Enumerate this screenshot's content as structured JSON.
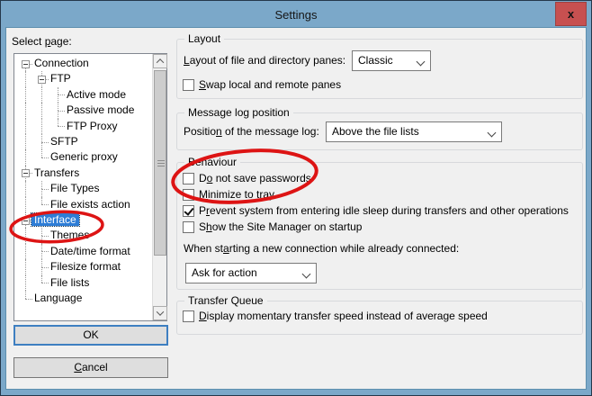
{
  "window": {
    "title": "Settings",
    "close_glyph": "x"
  },
  "sidebar": {
    "label": {
      "text": "Select page:",
      "accel": 7
    },
    "tree": [
      {
        "label": "Connection",
        "level": 0,
        "expand": true
      },
      {
        "label": "FTP",
        "level": 1,
        "expand": true
      },
      {
        "label": "Active mode",
        "level": 2
      },
      {
        "label": "Passive mode",
        "level": 2
      },
      {
        "label": "FTP Proxy",
        "level": 2
      },
      {
        "label": "SFTP",
        "level": 1
      },
      {
        "label": "Generic proxy",
        "level": 1
      },
      {
        "label": "Transfers",
        "level": 0,
        "expand": true
      },
      {
        "label": "File Types",
        "level": 1
      },
      {
        "label": "File exists action",
        "level": 1
      },
      {
        "label": "Interface",
        "level": 0,
        "expand": true,
        "selected": true
      },
      {
        "label": "Themes",
        "level": 1
      },
      {
        "label": "Date/time format",
        "level": 1
      },
      {
        "label": "Filesize format",
        "level": 1
      },
      {
        "label": "File lists",
        "level": 1
      },
      {
        "label": "Language",
        "level": 0
      }
    ]
  },
  "groups": {
    "layout": {
      "title": "Layout",
      "panes_label": {
        "text": "Layout of file and directory panes:",
        "accel": 0
      },
      "panes_value": "Classic",
      "swap_checkbox": {
        "id": "swap-local-remote",
        "text": "Swap local and remote panes",
        "accel": 0,
        "checked": false
      }
    },
    "message_log": {
      "title": "Message log position",
      "position_label": {
        "text": "Position of the message log:",
        "accel": 7
      },
      "position_value": "Above the file lists"
    },
    "behaviour": {
      "title": "Behaviour",
      "checkboxes": [
        {
          "id": "do-not-save-passwords",
          "text": "Do not save passwords",
          "accel": 1,
          "checked": false
        },
        {
          "id": "minimize-to-tray",
          "text": "Minimize to tray",
          "accel": 0,
          "checked": false
        },
        {
          "id": "prevent-idle-sleep",
          "text": "Prevent system from entering idle sleep during transfers and other operations",
          "accel": 1,
          "checked": true
        },
        {
          "id": "show-site-manager-on-startup",
          "text": "Show the Site Manager on startup",
          "accel": 1,
          "checked": false
        }
      ],
      "when_label": {
        "text": "When starting a new connection while already connected:",
        "accel": 7
      },
      "when_value": "Ask for action"
    },
    "transfer_queue": {
      "title": "Transfer Queue",
      "display_checkbox": {
        "id": "display-momentary-speed",
        "text": "Display momentary transfer speed instead of average speed",
        "accel": 0,
        "checked": false
      }
    }
  },
  "buttons": {
    "ok": {
      "text": "OK",
      "accel": -1
    },
    "cancel": {
      "text": "Cancel",
      "accel": 0
    }
  },
  "annotations": {
    "color": "#dd1414",
    "circled": [
      "Interface",
      "Do not save passwords"
    ]
  }
}
